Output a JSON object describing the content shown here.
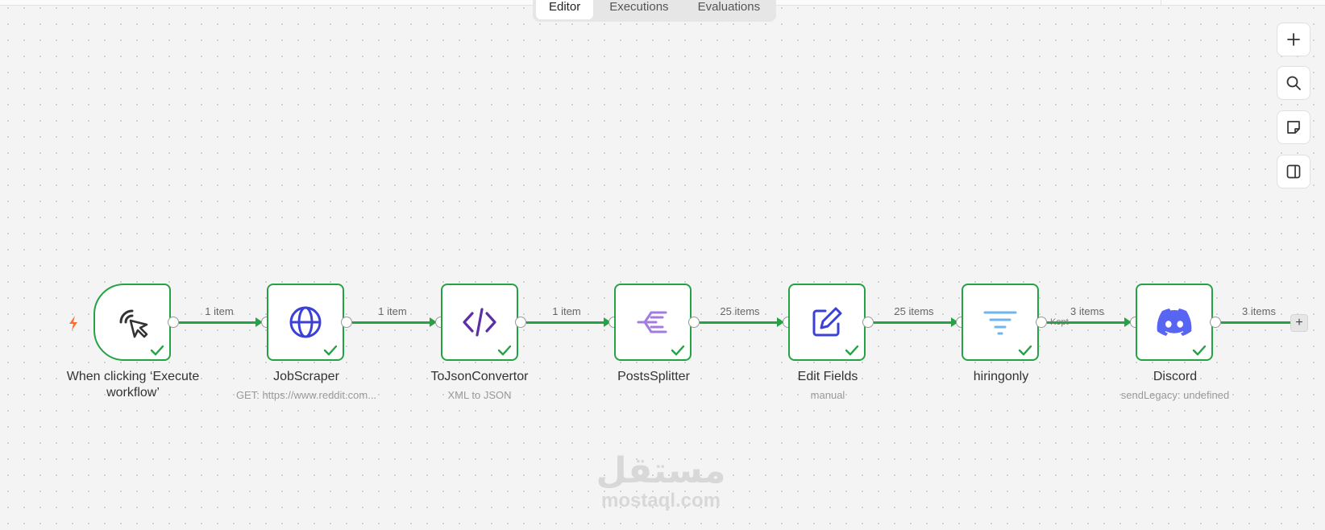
{
  "tabs": [
    {
      "label": "Editor",
      "active": true
    },
    {
      "label": "Executions",
      "active": false
    },
    {
      "label": "Evaluations",
      "active": false
    }
  ],
  "toolbar": [
    {
      "icon": "zoom-in-plus-icon"
    },
    {
      "icon": "search-icon"
    },
    {
      "icon": "sticky-note-icon"
    },
    {
      "icon": "side-panel-icon"
    }
  ],
  "nodes": [
    {
      "title": "When clicking ‘Execute workflow’",
      "subtitle": "",
      "icon": "cursor-click-icon"
    },
    {
      "title": "JobScraper",
      "subtitle": "GET: https://www.reddit.com...",
      "icon": "globe-icon"
    },
    {
      "title": "ToJsonConvertor",
      "subtitle": "XML to JSON",
      "icon": "code-icon"
    },
    {
      "title": "PostsSplitter",
      "subtitle": "",
      "icon": "split-icon"
    },
    {
      "title": "Edit Fields",
      "subtitle": "manual",
      "icon": "edit-pen-icon"
    },
    {
      "title": "hiringonly",
      "subtitle": "",
      "icon": "filter-icon"
    },
    {
      "title": "Discord",
      "subtitle": "sendLegacy: undefined",
      "icon": "discord-icon"
    }
  ],
  "edges": [
    {
      "label": "1 item"
    },
    {
      "label": "1 item"
    },
    {
      "label": "1 item"
    },
    {
      "label": "25 items"
    },
    {
      "label": "25 items"
    },
    {
      "label": "3 items",
      "branch": "Kept"
    },
    {
      "label": "3 items"
    }
  ],
  "colors": {
    "success": "#25a244",
    "trigger_bolt": "#ff6d2d",
    "http_icon": "#3b40d6",
    "code_icon": "#5b2fa6",
    "split_icon": "#a47ce0",
    "edit_icon": "#3b40d6",
    "filter_icon": "#6db6f0",
    "discord": "#5865f2"
  },
  "watermark": {
    "logo": "مستقل",
    "text": "mostaql.com"
  }
}
